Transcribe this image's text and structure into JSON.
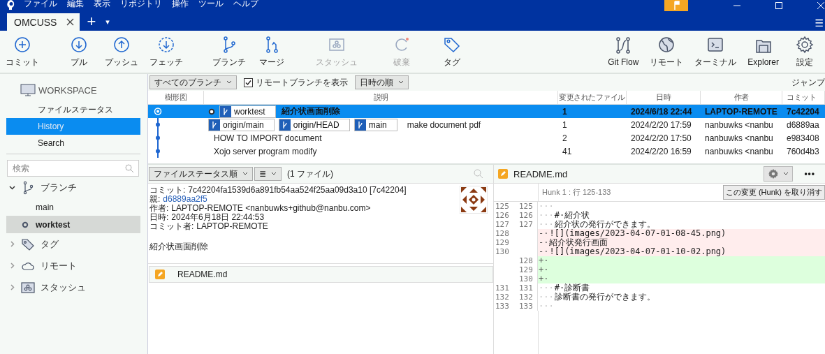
{
  "menu": [
    "ファイル",
    "編集",
    "表示",
    "リポジトリ",
    "操作",
    "ツール",
    "ヘルプ"
  ],
  "tabs": [
    {
      "label": "OMCUSS",
      "selected": true
    }
  ],
  "tab_add": "+",
  "tab_list": "▾",
  "hamburger": "☰",
  "toolbar": {
    "left": [
      {
        "label": "コミット",
        "kind": "commit",
        "disabled": false
      },
      {
        "label": "プル",
        "kind": "pull",
        "disabled": false
      },
      {
        "label": "プッシュ",
        "kind": "push",
        "disabled": false
      },
      {
        "label": "フェッチ",
        "kind": "fetch",
        "disabled": false
      },
      {
        "label": "ブランチ",
        "kind": "branch",
        "disabled": false
      },
      {
        "label": "マージ",
        "kind": "merge",
        "disabled": false
      },
      {
        "label": "スタッシュ",
        "kind": "stash",
        "disabled": true
      },
      {
        "label": "破棄",
        "kind": "discard",
        "disabled": true
      },
      {
        "label": "タグ",
        "kind": "tag",
        "disabled": false
      }
    ],
    "right": [
      {
        "label": "Git Flow",
        "kind": "gitflow",
        "disabled": false
      },
      {
        "label": "リモート",
        "kind": "remote",
        "disabled": false
      },
      {
        "label": "ターミナル",
        "kind": "terminal",
        "disabled": false
      },
      {
        "label": "Explorer",
        "kind": "explorer",
        "disabled": false
      },
      {
        "label": "設定",
        "kind": "settings",
        "disabled": false
      }
    ]
  },
  "sidebar": {
    "workspace": {
      "title": "WORKSPACE",
      "items": [
        {
          "label": "ファイルステータス",
          "selected": false
        },
        {
          "label": "History",
          "selected": true
        },
        {
          "label": "Search",
          "selected": false
        }
      ]
    },
    "search": {
      "placeholder": "検索"
    },
    "sections": [
      {
        "label": "ブランチ",
        "kind": "branch",
        "expanded": true,
        "children": [
          {
            "label": "main",
            "current": false,
            "selected": false
          },
          {
            "label": "worktest",
            "current": true,
            "selected": true
          }
        ]
      },
      {
        "label": "タグ",
        "kind": "tag",
        "expanded": false
      },
      {
        "label": "リモート",
        "kind": "remote",
        "expanded": false
      },
      {
        "label": "スタッシュ",
        "kind": "stash",
        "expanded": false
      }
    ]
  },
  "filters": {
    "branches": "すべてのブランチ",
    "show_remote": {
      "label": "リモートブランチを表示",
      "checked": true
    },
    "order": "日時の順",
    "jump": "ジャンプ"
  },
  "table": {
    "columns": [
      "樹形図",
      "説明",
      "変更されたファイル",
      "日時",
      "作者",
      "コミット"
    ],
    "rows": [
      {
        "selected": true,
        "head": true,
        "current_marker": true,
        "refs": [
          "worktest"
        ],
        "message": "紹介状画面削除",
        "files": "1",
        "date": "2024/6/18  22:44",
        "author": "LAPTOP-REMOTE",
        "commit": "7c42204"
      },
      {
        "selected": false,
        "head": false,
        "current_marker": false,
        "refs": [
          "origin/main",
          "origin/HEAD",
          "main"
        ],
        "message": "make document pdf",
        "files": "1",
        "date": "2024/2/20  17:59",
        "author": "nanbuwks <nanbu",
        "commit": "d6889aa"
      },
      {
        "selected": false,
        "head": false,
        "current_marker": false,
        "refs": [],
        "message": "HOW TO IMPORT document",
        "files": "2",
        "date": "2024/2/20  17:50",
        "author": "nanbuwks <nanbu",
        "commit": "e983408"
      },
      {
        "selected": false,
        "head": false,
        "current_marker": false,
        "refs": [],
        "message": "Xojo server program modify",
        "files": "41",
        "date": "2024/2/20  16:59",
        "author": "nanbuwks <nanbu",
        "commit": "760d4b3"
      }
    ]
  },
  "details": {
    "sort": "ファイルステータス順",
    "view": "≣",
    "count": "(1 ファイル)",
    "lines": [
      {
        "label": "コミット:",
        "value": "7c42204fa1539d6a891fb54aa524f25aa09d3a10 [7c42204]",
        "link": false
      },
      {
        "label": "親:",
        "value": "d6889aa2f5",
        "link": true
      },
      {
        "label": "作者:",
        "value": "LAPTOP-REMOTE <nanbuwks+github@nanbu.com>",
        "link": false
      },
      {
        "label": "日時:",
        "value": "2024年6月18日 22:44:53",
        "link": false
      },
      {
        "label": "コミット者:",
        "value": "LAPTOP-REMOTE",
        "link": false
      }
    ],
    "message": "紹介状画面削除",
    "files": [
      {
        "name": "README.md"
      }
    ]
  },
  "diff": {
    "file": "README.md",
    "more": "•••",
    "hunk": "Hunk 1 : 行 125-133",
    "discard": "この変更 (Hunk) を取り消す",
    "lines": [
      {
        "kind": "context",
        "old": "125",
        "new": "125",
        "marker": "···"
      },
      {
        "kind": "context",
        "old": "126",
        "new": "126",
        "marker": "···",
        "text": "#·紹介状"
      },
      {
        "kind": "context",
        "old": "127",
        "new": "127",
        "marker": "···",
        "text": "紹介状の発行ができます。"
      },
      {
        "kind": "removed",
        "old": "128",
        "marker": "-·",
        "text": "![](images/2023-04-07-01-08-45.png)"
      },
      {
        "kind": "removed",
        "old": "129",
        "marker": "-·",
        "text": "紹介状発行画面"
      },
      {
        "kind": "removed",
        "old": "130",
        "marker": "-·",
        "text": "![](images/2023-04-07-01-10-02.png)"
      },
      {
        "kind": "added",
        "new": "128",
        "marker": "+·"
      },
      {
        "kind": "added",
        "new": "129",
        "marker": "+·"
      },
      {
        "kind": "added",
        "new": "130",
        "marker": "+·"
      },
      {
        "kind": "context",
        "old": "131",
        "new": "131",
        "marker": "···",
        "text": "#·診断書"
      },
      {
        "kind": "context",
        "old": "132",
        "new": "132",
        "marker": "···",
        "text": "診断書の発行ができます。"
      },
      {
        "kind": "context",
        "old": "133",
        "new": "133",
        "marker": "···"
      }
    ]
  }
}
